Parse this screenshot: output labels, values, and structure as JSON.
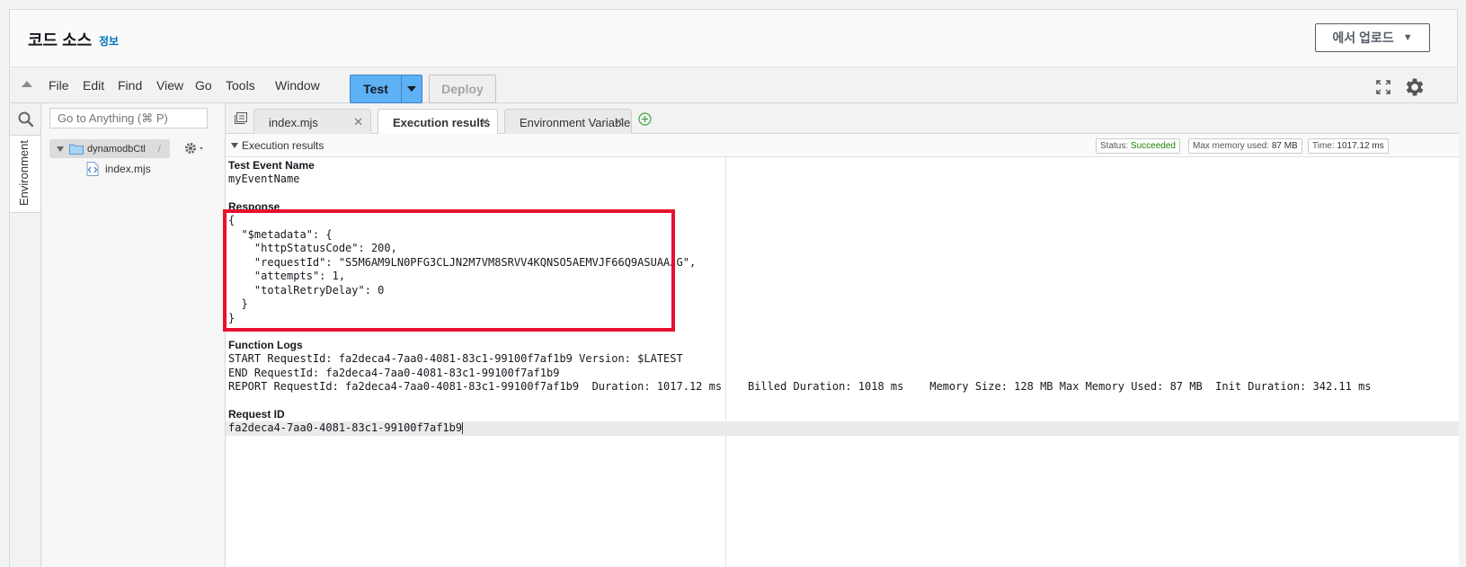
{
  "header": {
    "title": "코드 소스",
    "info_link": "정보",
    "upload_button": "에서 업로드"
  },
  "menu": {
    "items": [
      "File",
      "Edit",
      "Find",
      "View",
      "Go",
      "Tools",
      "Window"
    ],
    "test_button": "Test",
    "deploy_button": "Deploy"
  },
  "sidebar": {
    "rail_tab": "Environment",
    "goto_placeholder": "Go to Anything (⌘ P)",
    "folder_name": "dynamodbCtl",
    "folder_slash": "/",
    "file_name": "index.mjs"
  },
  "tabs": [
    {
      "label": "index.mjs"
    },
    {
      "label": "Execution results"
    },
    {
      "label": "Environment Variables"
    }
  ],
  "results": {
    "header_title": "Execution results",
    "status_label": "Status:",
    "status_value": "Succeeded",
    "memory_label": "Max memory used:",
    "memory_value": "87 MB",
    "time_label": "Time:",
    "time_value": "1017.12 ms",
    "test_event_label": "Test Event Name",
    "test_event_value": "myEventName",
    "response_label": "Response",
    "response_body": "{\n  \"$metadata\": {\n    \"httpStatusCode\": 200,\n    \"requestId\": \"S5M6AM9LN0PFG3CLJN2M7VM8SRVV4KQNSO5AEMVJF66Q9ASUAAJG\",\n    \"attempts\": 1,\n    \"totalRetryDelay\": 0\n  }\n}",
    "function_logs_label": "Function Logs",
    "function_logs": "START RequestId: fa2deca4-7aa0-4081-83c1-99100f7af1b9 Version: $LATEST\nEND RequestId: fa2deca4-7aa0-4081-83c1-99100f7af1b9\nREPORT RequestId: fa2deca4-7aa0-4081-83c1-99100f7af1b9  Duration: 1017.12 ms    Billed Duration: 1018 ms    Memory Size: 128 MB Max Memory Used: 87 MB  Init Duration: 342.11 ms",
    "request_id_label": "Request ID",
    "request_id_value": "fa2deca4-7aa0-4081-83c1-99100f7af1b9"
  },
  "colors": {
    "accent_test": "#5eb1f5",
    "success": "#1d8102",
    "highlight": "#e8112d",
    "link": "#0073bb"
  }
}
